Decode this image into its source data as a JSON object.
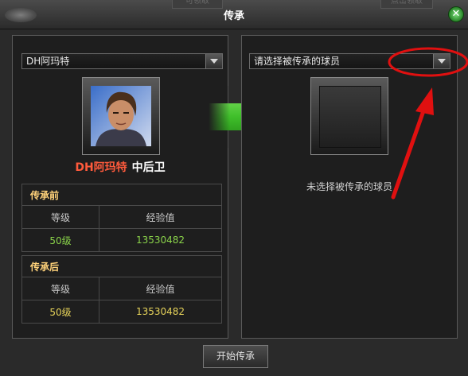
{
  "window": {
    "title": "传承",
    "tab_left": "可领取",
    "tab_right": "点击领取",
    "close_label": "✕"
  },
  "left": {
    "select_value": "DH阿玛特",
    "player_name": "DH阿玛特",
    "position": "中后卫",
    "before": {
      "section_label": "传承前",
      "col_level": "等级",
      "col_exp": "经验值",
      "level": "50级",
      "exp": "13530482"
    },
    "after": {
      "section_label": "传承后",
      "col_level": "等级",
      "col_exp": "经验值",
      "level": "50级",
      "exp": "13530482"
    }
  },
  "right": {
    "select_placeholder": "请选择被传承的球员",
    "empty_label": "未选择被传承的球员"
  },
  "actions": {
    "start_label": "开始传承"
  },
  "colors": {
    "name_red": "#ff5a3c",
    "section_yellow": "#ffd27a",
    "value_green": "#8ad34a",
    "value_yellow": "#e6d35a",
    "arrow_green": "#3fbf2a",
    "annotation_red": "#e01010"
  },
  "icons": [
    "close-icon",
    "dropdown-arrow-icon",
    "transfer-arrow-icon"
  ]
}
